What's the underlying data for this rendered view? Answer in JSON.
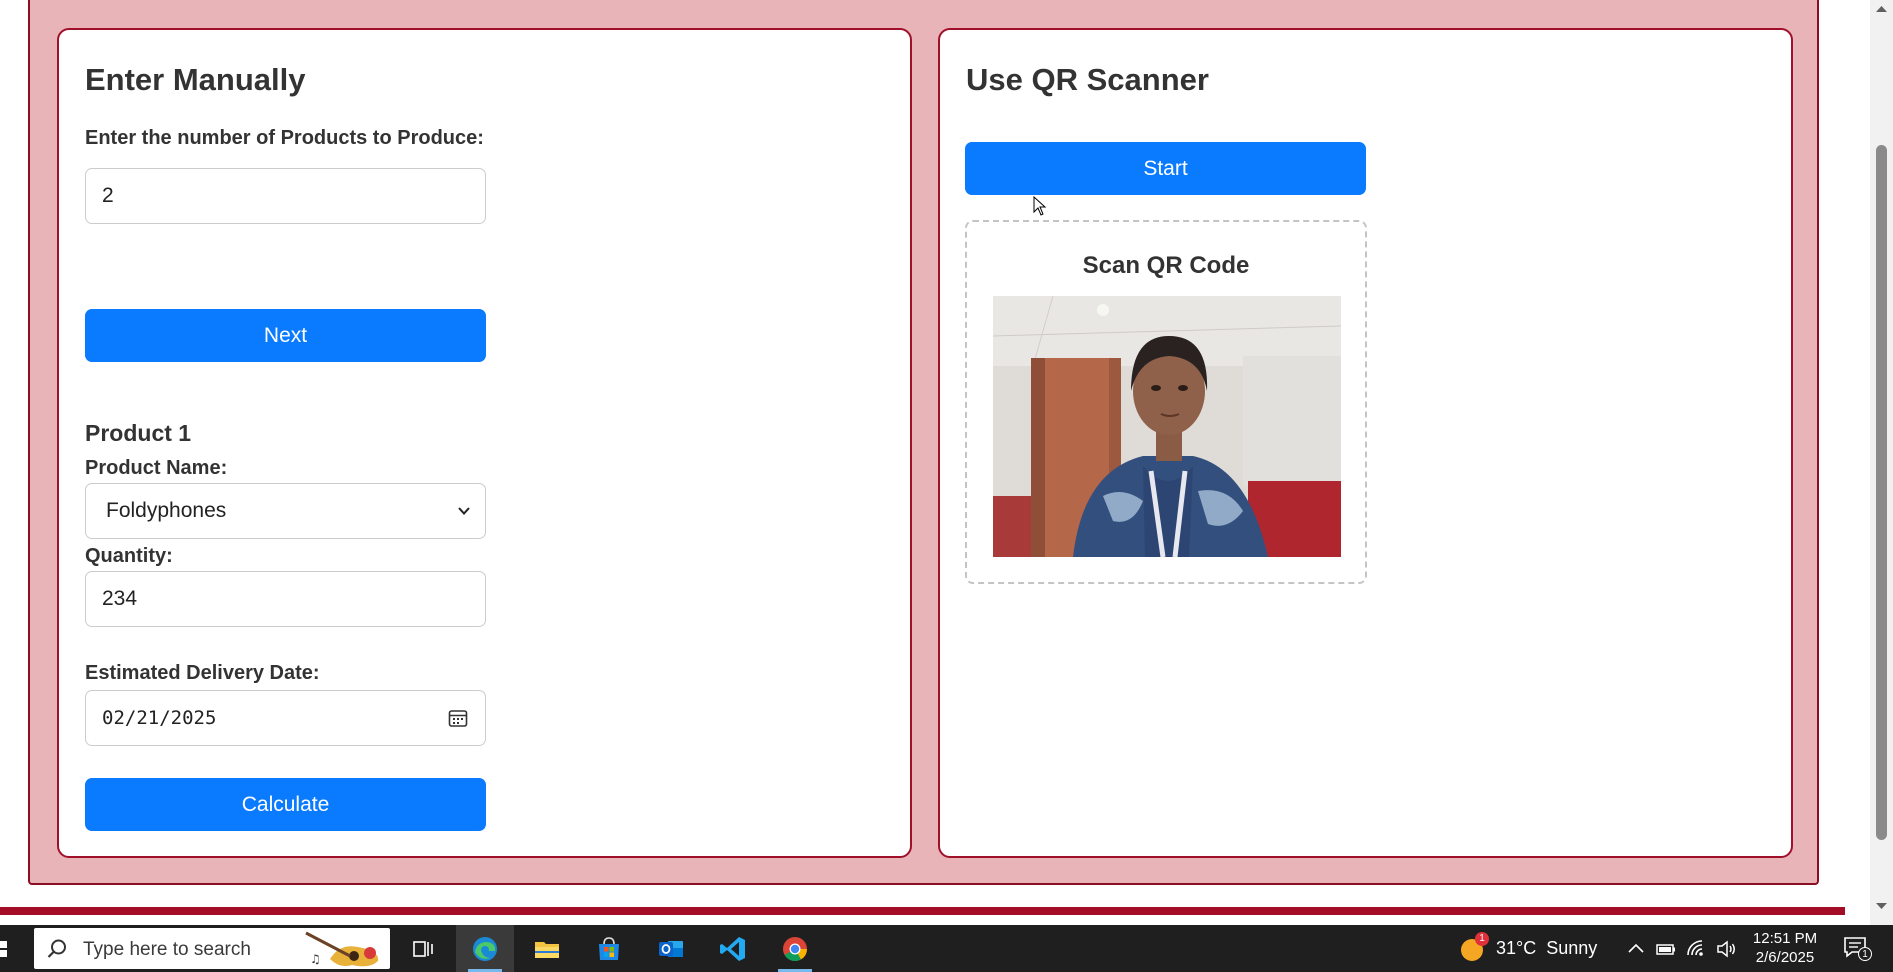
{
  "manual": {
    "title": "Enter Manually",
    "count_label": "Enter the number of Products to Produce:",
    "count_value": "2",
    "next_label": "Next",
    "product_heading": "Product 1",
    "product_name_label": "Product Name:",
    "product_name_value": "Foldyphones",
    "quantity_label": "Quantity:",
    "quantity_value": "234",
    "delivery_label": "Estimated Delivery Date:",
    "delivery_value": "02/21/2025",
    "calculate_label": "Calculate"
  },
  "qr": {
    "title": "Use QR Scanner",
    "start_label": "Start",
    "scan_title": "Scan QR Code"
  },
  "taskbar": {
    "search_placeholder": "Type here to search",
    "apps": [
      "task-view",
      "edge",
      "file-explorer",
      "microsoft-store",
      "outlook",
      "vs-code",
      "chrome"
    ],
    "weather_text": "31°C  Sunny",
    "weather_badge": "1",
    "time": "12:51 PM",
    "date": "2/6/2025",
    "notification_count": "1"
  },
  "colors": {
    "accent_blue": "#0a7bff",
    "panel_pink": "#e8b4b8",
    "border_maroon": "#a0102a",
    "taskbar": "#1f1f1f"
  }
}
